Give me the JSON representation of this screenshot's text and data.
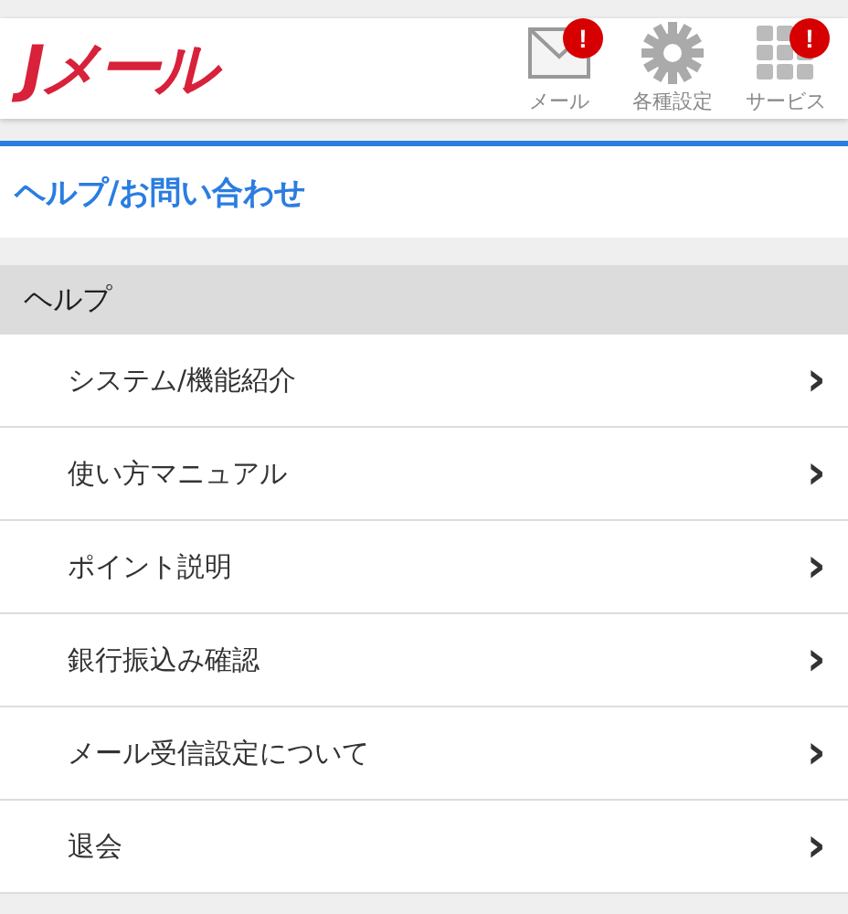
{
  "header": {
    "logo": "Jメール",
    "nav": [
      {
        "kind": "mail",
        "label": "メール",
        "badge": "!"
      },
      {
        "kind": "gear",
        "label": "各種設定"
      },
      {
        "kind": "grid",
        "label": "サービス",
        "badge": "!"
      }
    ]
  },
  "page_title": "ヘルプ/お問い合わせ",
  "section": {
    "title": "ヘルプ",
    "items": [
      {
        "label": "システム/機能紹介",
        "arrow": "›"
      },
      {
        "label": "使い方マニュアル",
        "arrow": "›"
      },
      {
        "label": "ポイント説明",
        "arrow": "›"
      },
      {
        "label": "銀行振込み確認",
        "arrow": "›"
      },
      {
        "label": "メール受信設定について",
        "arrow": "›"
      },
      {
        "label": "退会",
        "arrow": "›"
      }
    ]
  }
}
